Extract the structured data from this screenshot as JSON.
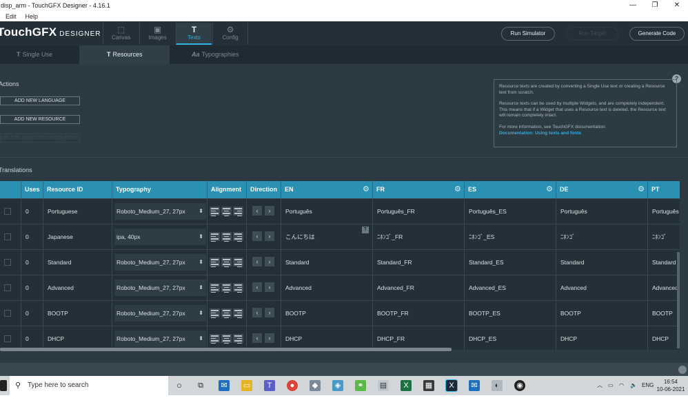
{
  "window": {
    "title": "disp_arm - TouchGFX Designer - 4.16.1",
    "min": "—",
    "max": "❐",
    "close": "✕"
  },
  "menu": [
    "Edit",
    "Help"
  ],
  "logo": {
    "brand": "TouchGFX",
    "sub": "DESIGNER"
  },
  "main_tabs": [
    {
      "label": "Canvas",
      "icon": "canvas-icon",
      "glyph": "⬚"
    },
    {
      "label": "Images",
      "icon": "image-icon",
      "glyph": "▣"
    },
    {
      "label": "Texts",
      "icon": "text-icon",
      "glyph": "T"
    },
    {
      "label": "Config",
      "icon": "gear-icon",
      "glyph": "⚙"
    }
  ],
  "actions_bar": {
    "run_simulator": "Run Simulator",
    "run_target": "Run Target",
    "generate_code": "Generate Code"
  },
  "sub_tabs": [
    {
      "label": "Single Use",
      "icon": "T"
    },
    {
      "label": "Resources",
      "icon": "T"
    },
    {
      "label": "Typographies",
      "icon": "Aa"
    }
  ],
  "actions": {
    "title": "Actions",
    "add_language": "ADD NEW LANGUAGE",
    "add_resource": "ADD NEW RESOURCE",
    "delete_selected": "DELETE SELECTED RESOURCES"
  },
  "info": {
    "help": "?",
    "p1": "Resource texts are created by converting a Single Use text or creating a Resource text from scratch.",
    "p2": "Resource texts can be used by multiple Widgets, and are completely independent. This means that if a Widget that uses a Resource text is deleted, the Resource text will remain completely intact.",
    "p3": "For more information, see TouchGFX documentation:",
    "link": "Documentation: Using texts and fonts"
  },
  "translations": {
    "title": "Translations",
    "columns": [
      "Uses",
      "Resource ID",
      "Typography",
      "Alignment",
      "Direction",
      "EN",
      "FR",
      "ES",
      "DE",
      "PT"
    ],
    "rows": [
      {
        "uses": "0",
        "id": "Portuguese",
        "typography": "Roboto_Medium_27, 27px",
        "en": "Português",
        "fr": "Português_FR",
        "es": "Português_ES",
        "de": "Português",
        "pt": "Português"
      },
      {
        "uses": "0",
        "id": "Japanese",
        "typography": "ipa, 40px",
        "en": "こんにちは",
        "fr": "ﾆﾎﾝｺﾞ_FR",
        "es": "ﾆﾎﾝｺﾞ_ES",
        "de": "ﾆﾎﾝｺﾞ",
        "pt": "ﾆﾎﾝｺﾞ"
      },
      {
        "uses": "0",
        "id": "Standard",
        "typography": "Roboto_Medium_27, 27px",
        "en": "Standard",
        "fr": "Standard_FR",
        "es": "Standard_ES",
        "de": "Standard",
        "pt": "Standard"
      },
      {
        "uses": "0",
        "id": "Advanced",
        "typography": "Roboto_Medium_27, 27px",
        "en": "Advanced",
        "fr": "Advanced_FR",
        "es": "Advanced_ES",
        "de": "Advanced",
        "pt": "Advanced"
      },
      {
        "uses": "0",
        "id": "BOOTP",
        "typography": "Roboto_Medium_27, 27px",
        "en": "BOOTP",
        "fr": "BOOTP_FR",
        "es": "BOOTP_ES",
        "de": "BOOTP",
        "pt": "BOOTP"
      },
      {
        "uses": "0",
        "id": "DHCP",
        "typography": "Roboto_Medium_27, 27px",
        "en": "DHCP",
        "fr": "DHCP_FR",
        "es": "DHCP_ES",
        "de": "DHCP",
        "pt": "DHCP"
      }
    ]
  },
  "taskbar": {
    "search_placeholder": "Type here to search",
    "lang": "ENG",
    "time": "16:54",
    "date": "10-06-2021"
  },
  "colors": {
    "accent": "#2fb0e6",
    "header": "#2a91b4",
    "bg": "#2c3a42"
  }
}
